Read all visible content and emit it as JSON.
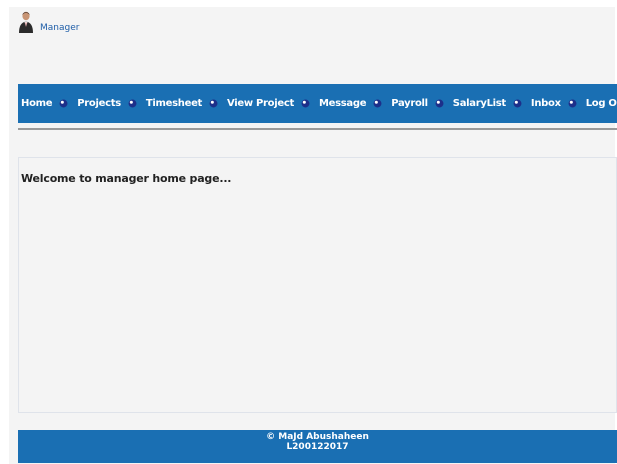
{
  "header": {
    "user_label": "Manager"
  },
  "nav": {
    "items": [
      {
        "label": "Home"
      },
      {
        "label": "Projects"
      },
      {
        "label": "Timesheet"
      },
      {
        "label": "View Project"
      },
      {
        "label": "Message"
      },
      {
        "label": "Payroll"
      },
      {
        "label": "SalaryList"
      },
      {
        "label": "Inbox"
      },
      {
        "label": "Log Out"
      }
    ]
  },
  "main": {
    "welcome_text": "Welcome to manager home page..."
  },
  "footer": {
    "line1": "© MaJd Abushaheen",
    "line2": "L200122017"
  },
  "colors": {
    "nav_bg": "#1a6fb3",
    "page_bg": "#f4f4f4",
    "link": "#1f5ea8"
  },
  "icons": {
    "avatar": "manager-avatar-icon",
    "nav_bullet": "blue-orb-bullet-icon"
  }
}
